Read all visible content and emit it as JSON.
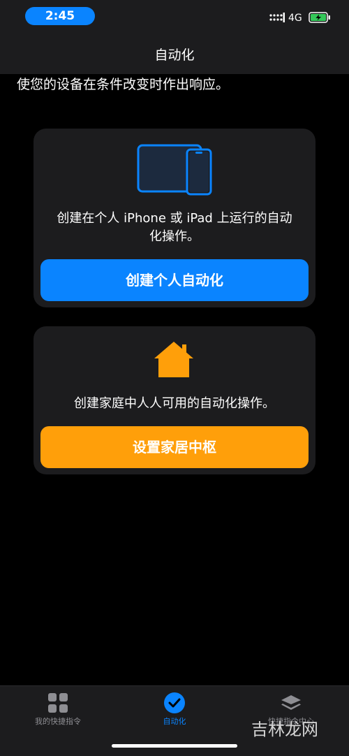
{
  "status_bar": {
    "time": "2:45",
    "network": "4G",
    "icons": [
      "signal-icon",
      "battery-charging-icon"
    ]
  },
  "nav": {
    "title": "自动化"
  },
  "subtitle": "使您的设备在条件改变时作出响应。",
  "cards": {
    "personal": {
      "icon": "iphone-ipad-icon",
      "description_line1": "创建在个人 iPhone 或 iPad 上运行的自动",
      "description_line2": "化操作。",
      "button_label": "创建个人自动化",
      "button_color": "#0a84ff"
    },
    "home": {
      "icon": "home-icon",
      "description": "创建家庭中人人可用的自动化操作。",
      "button_label": "设置家居中枢",
      "button_color": "#ff9f0a"
    }
  },
  "tab_bar": {
    "tabs": [
      {
        "label": "我的快捷指令",
        "icon": "grid-icon",
        "active": false
      },
      {
        "label": "自动化",
        "icon": "clock-check-icon",
        "active": true
      },
      {
        "label": "快捷指令中心",
        "icon": "layers-icon",
        "active": false
      }
    ]
  },
  "watermark": "吉林龙网",
  "colors": {
    "accent": "#0a84ff",
    "home_accent": "#ff9f0a",
    "card_background": "#1c1c1e",
    "background": "#000000"
  }
}
